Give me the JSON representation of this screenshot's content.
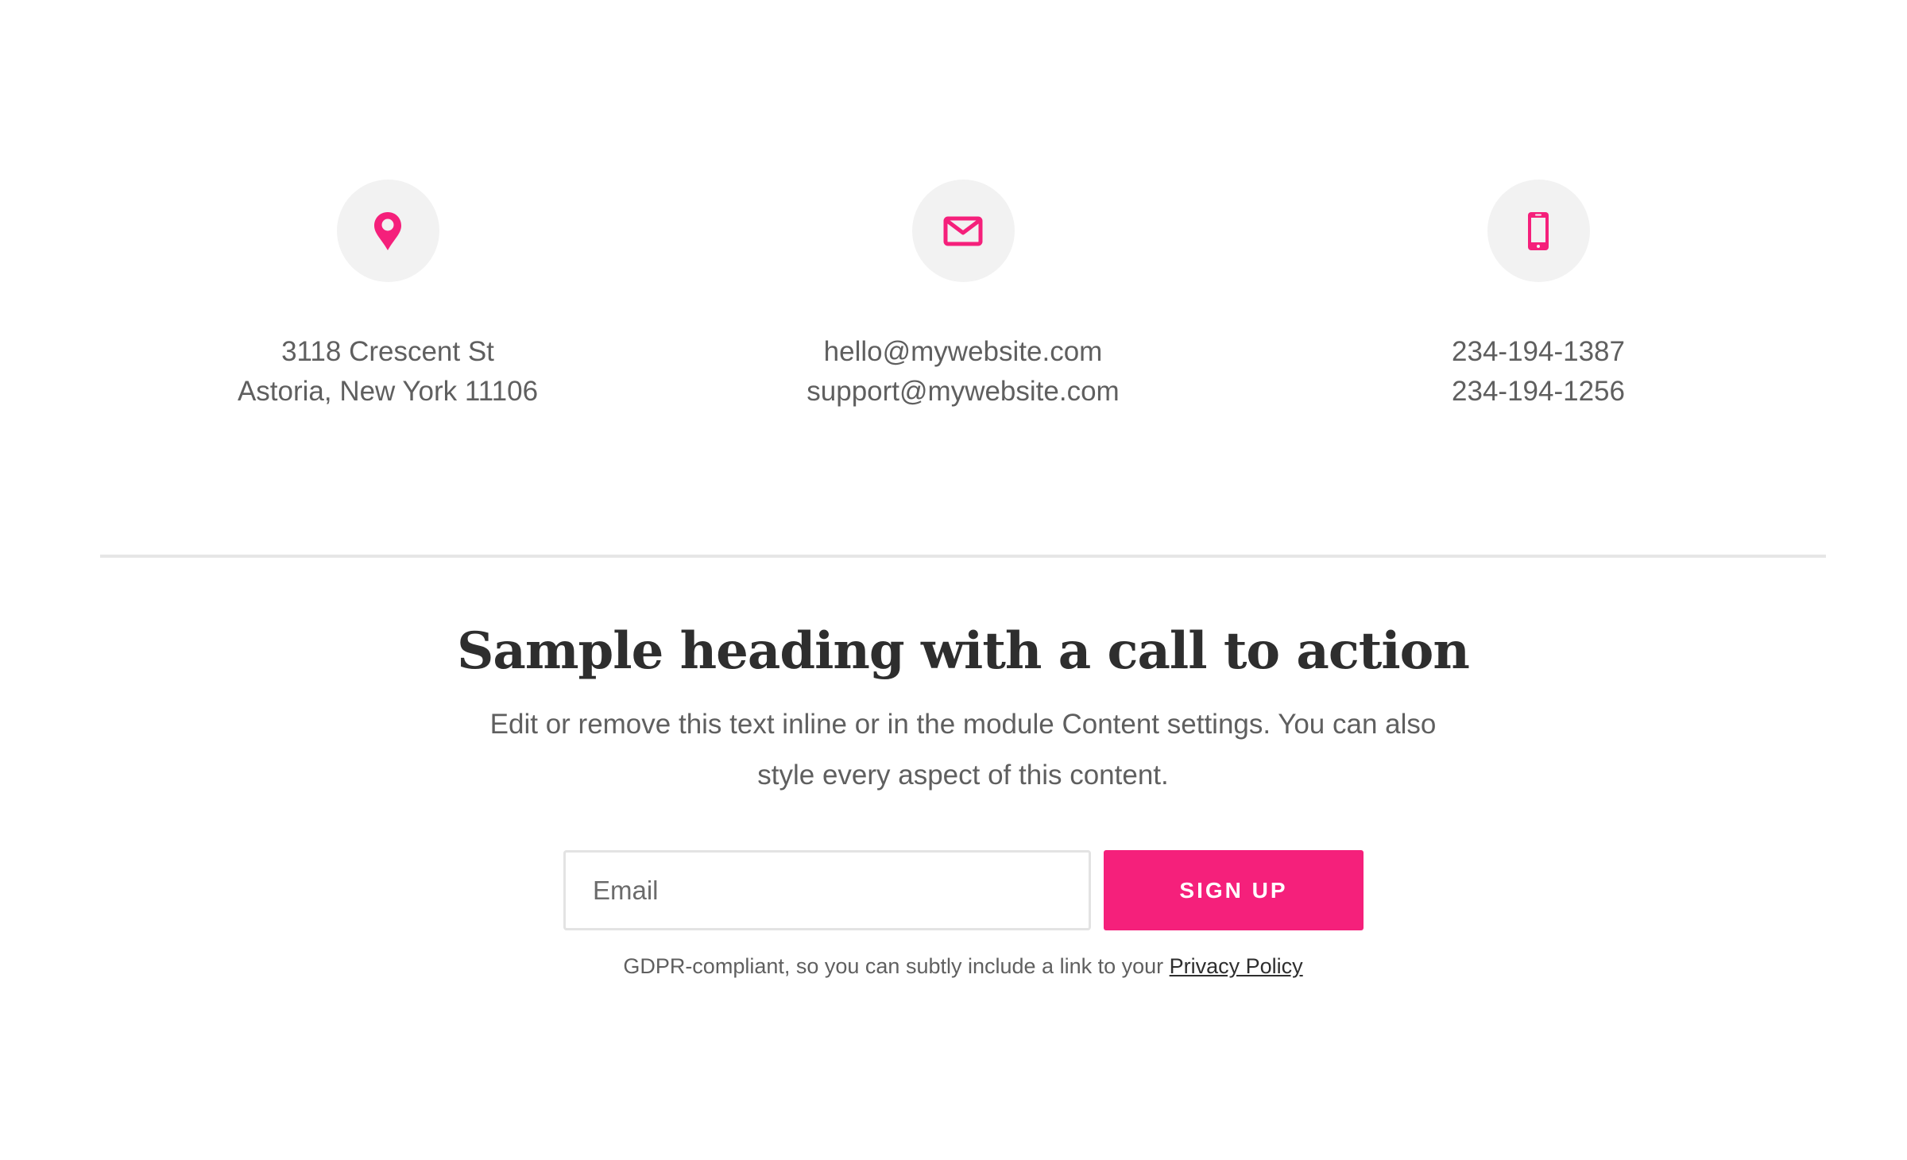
{
  "contact": {
    "address": {
      "icon": "map-pin-icon",
      "line1": "3118 Crescent St",
      "line2": "Astoria, New York 11106"
    },
    "email": {
      "icon": "envelope-icon",
      "line1": "hello@mywebsite.com",
      "line2": "support@mywebsite.com"
    },
    "phone": {
      "icon": "mobile-phone-icon",
      "line1": "234-194-1387",
      "line2": "234-194-1256"
    }
  },
  "cta": {
    "heading": "Sample heading with a call to action",
    "text": "Edit or remove this text inline or in the module Content settings. You can also style every aspect of this content."
  },
  "signup": {
    "email_placeholder": "Email",
    "email_value": "",
    "button_label": "SIGN UP",
    "note_text": "GDPR-compliant, so you can subtly include a link to your ",
    "privacy_link": "Privacy Policy"
  },
  "colors": {
    "accent": "#f5207b",
    "icon_circle": "#f2f2f2",
    "divider": "#e6e6e6",
    "heading": "#2e2e2e",
    "body_text": "#5f5f5f"
  }
}
